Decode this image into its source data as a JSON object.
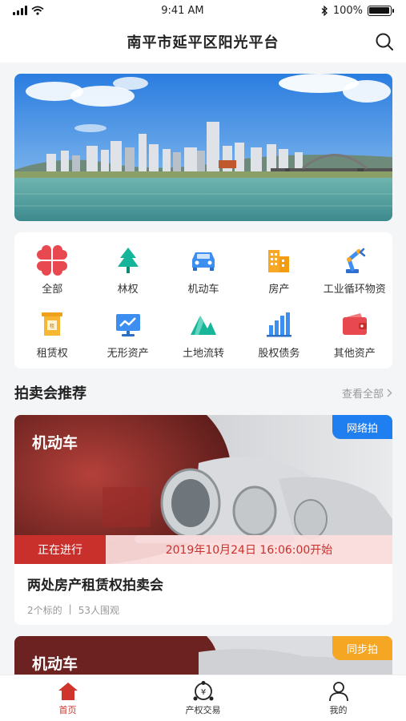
{
  "status_bar": {
    "time": "9:41 AM",
    "battery": "100%"
  },
  "header": {
    "title": "南平市延平区阳光平台"
  },
  "categories": [
    {
      "label": "全部",
      "icon": "grid-petals-icon"
    },
    {
      "label": "林权",
      "icon": "tree-icon"
    },
    {
      "label": "机动车",
      "icon": "car-icon"
    },
    {
      "label": "房产",
      "icon": "building-icon"
    },
    {
      "label": "工业循环物资",
      "icon": "robot-arm-icon"
    },
    {
      "label": "租赁权",
      "icon": "lease-sign-icon"
    },
    {
      "label": "无形资产",
      "icon": "monitor-chart-icon"
    },
    {
      "label": "土地流转",
      "icon": "mountain-icon"
    },
    {
      "label": "股权债务",
      "icon": "bar-chart-icon"
    },
    {
      "label": "其他资产",
      "icon": "wallet-icon"
    }
  ],
  "section": {
    "title": "拍卖会推荐",
    "see_all": "查看全部"
  },
  "auctions": [
    {
      "category": "机动车",
      "badge": "网络拍",
      "status": "正在进行",
      "start_time": "2019年10月24日  16:06:00开始",
      "title": "两处房产租赁权拍卖会",
      "lots": "2个标的",
      "viewers": "53人围观"
    },
    {
      "category": "机动车",
      "badge": "同步拍"
    }
  ],
  "tabbar": [
    {
      "label": "首页",
      "icon": "home-icon",
      "active": true
    },
    {
      "label": "产权交易",
      "icon": "exchange-icon",
      "active": false
    },
    {
      "label": "我的",
      "icon": "user-icon",
      "active": false
    }
  ],
  "colors": {
    "brand_red": "#d0352d",
    "badge_blue": "#1f7ff0",
    "badge_orange": "#f5a623"
  }
}
